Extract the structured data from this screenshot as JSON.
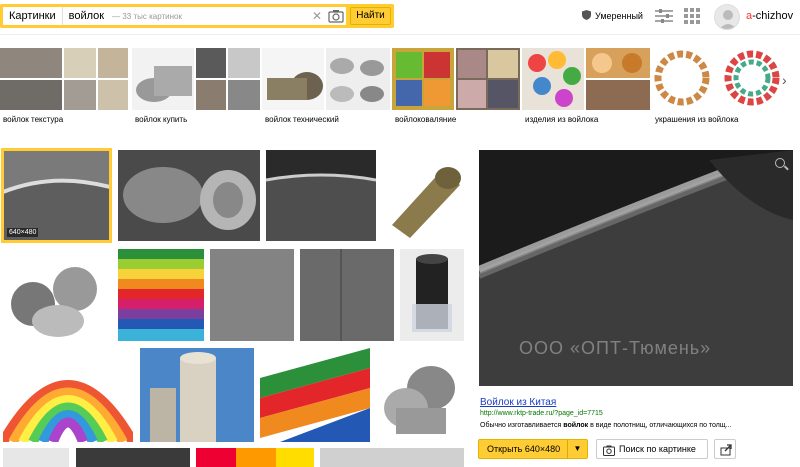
{
  "header": {
    "service_tab": "Картинки",
    "query": "войлок",
    "hint": "— 33 тыс картинок",
    "find_label": "Найти",
    "safe_search": "Умеренный",
    "user_first": "a",
    "user_rest": "-chizhov"
  },
  "related": [
    {
      "label": "войлок текстура"
    },
    {
      "label": "войлок купить"
    },
    {
      "label": "войлок технический"
    },
    {
      "label": "войлоковаляние"
    },
    {
      "label": "изделия из войлока"
    },
    {
      "label": "украшения из войлока"
    }
  ],
  "results": {
    "selected_size": "640×480"
  },
  "preview": {
    "watermark": "ООО «ОПТ-Тюмень»",
    "title": "Войлок из Китая",
    "url": "http://www.rktp-trade.ru/?page_id=7715",
    "desc_pre": "Обычно изготавливается ",
    "desc_bold": "войлок",
    "desc_post": " в виде полотнищ, отличающихся по толщ...",
    "open_label": "Открыть 640×480",
    "search_label": "Поиск по картинке"
  },
  "colors": {
    "accent": "#ffcc33",
    "link": "#1a3dc1",
    "url": "#007700"
  },
  "icons": [
    "clear-icon",
    "camera-icon",
    "shield-icon",
    "settings-icon",
    "grid-icon",
    "avatar",
    "chevron-right-icon",
    "zoom-icon",
    "share-icon"
  ]
}
